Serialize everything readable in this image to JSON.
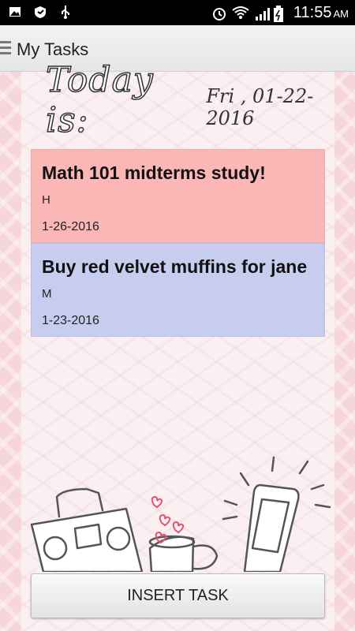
{
  "status_bar": {
    "time": "11:55",
    "ampm": "AM"
  },
  "app_bar": {
    "title": "My Tasks"
  },
  "header": {
    "today_label": "Today is:",
    "date": "Fri , 01-22-2016"
  },
  "tasks": [
    {
      "title": "Math 101 midterms study!",
      "priority": "H",
      "due": "1-26-2016",
      "color": "#fbb6b6"
    },
    {
      "title": "Buy red velvet muffins for jane",
      "priority": "M",
      "due": "1-23-2016",
      "color": "#c7cdef"
    }
  ],
  "footer": {
    "insert_label": "INSERT TASK"
  },
  "icons": [
    "image-icon",
    "shield-icon",
    "usb-icon",
    "alarm-icon",
    "wifi-icon",
    "signal-icon",
    "battery-icon",
    "menu-icon"
  ]
}
